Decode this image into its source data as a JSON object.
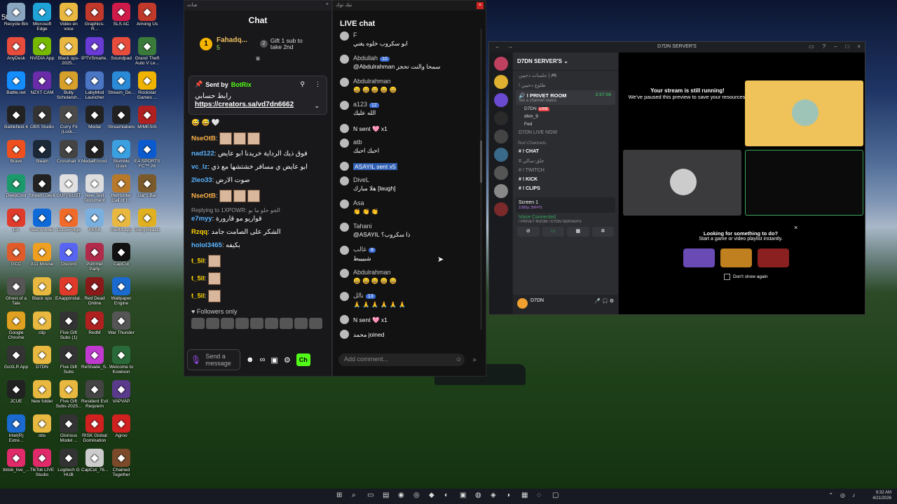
{
  "desktop": {
    "money_text": "50,00$",
    "icons": [
      {
        "label": "Recycle Bin",
        "color": "#8aa6c1"
      },
      {
        "label": "Microsoft Edge",
        "color": "#1fa3d6"
      },
      {
        "label": "Vidéo en voce",
        "color": "#e8b840"
      },
      {
        "label": "Graphics-R...",
        "color": "#c0392b"
      },
      {
        "label": "SLS AC",
        "color": "#d01b4a"
      },
      {
        "label": "Among Us",
        "color": "#c0392b"
      },
      {
        "label": "AnyDesk",
        "color": "#e74c3c"
      },
      {
        "label": "NVIDIA App",
        "color": "#76b900"
      },
      {
        "label": "Black ops-2025...",
        "color": "#e8b840"
      },
      {
        "label": "IPTVSmarte...",
        "color": "#6a3ad4"
      },
      {
        "label": "Soundpad",
        "color": "#e74c3c"
      },
      {
        "label": "Grand Theft Auto V Le...",
        "color": "#3a7a3a"
      },
      {
        "label": "Battle.net",
        "color": "#148eff"
      },
      {
        "label": "NZXT CAM",
        "color": "#6a2ca8"
      },
      {
        "label": "Bully Scholarsh...",
        "color": "#d6a02a"
      },
      {
        "label": "LabyMod Launcher",
        "color": "#4a76c4"
      },
      {
        "label": "Stream_De...",
        "color": "#2a8ad6"
      },
      {
        "label": "Rockstar Games ...",
        "color": "#f0b400"
      },
      {
        "label": "Battlefield 6",
        "color": "#222"
      },
      {
        "label": "OBS Studio",
        "color": "#333"
      },
      {
        "label": "Curry Fit (Lock...",
        "color": "#4a4a4a"
      },
      {
        "label": "Medal",
        "color": "#222"
      },
      {
        "label": "Streamlabels",
        "color": "#222"
      },
      {
        "label": "MIMESIS",
        "color": "#b02020"
      },
      {
        "label": "Brave",
        "color": "#f0501e"
      },
      {
        "label": "Steam",
        "color": "#1b2838"
      },
      {
        "label": "Crosshair X",
        "color": "#444"
      },
      {
        "label": "MedalEncod...",
        "color": "#222"
      },
      {
        "label": "Stumble Guys",
        "color": "#3aa0e0"
      },
      {
        "label": "EA SPORTS FC™ 26",
        "color": "#0a5ad0"
      },
      {
        "label": "DeepCool",
        "color": "#1a9a6a"
      },
      {
        "label": "Stream Deck",
        "color": "#222"
      },
      {
        "label": "GUFFBUST",
        "color": "#e0e0e0"
      },
      {
        "label": "New Text Document",
        "color": "#dddddd"
      },
      {
        "label": "theHunter Call of t...",
        "color": "#b87a2a"
      },
      {
        "label": "Liar's Bar",
        "color": "#7a5a2a"
      },
      {
        "label": "EA",
        "color": "#e03a2a"
      },
      {
        "label": "TeamViewer",
        "color": "#0e6ad8"
      },
      {
        "label": "CurseForge",
        "color": "#f06a2a"
      },
      {
        "label": "PEAK",
        "color": "#7ab0e0"
      },
      {
        "label": "RedM.app",
        "color": "#e8b840"
      },
      {
        "label": "Gang Beasts",
        "color": "#e0b020"
      },
      {
        "label": "GCC",
        "color": "#e05a2a"
      },
      {
        "label": "X11 Mouse",
        "color": "#f0a020"
      },
      {
        "label": "Discord",
        "color": "#5865f2"
      },
      {
        "label": "Pummel Party",
        "color": "#b02a4a"
      },
      {
        "label": "CapCut",
        "color": "#111"
      },
      {
        "label": "Ghost of a Tale",
        "color": "#555"
      },
      {
        "label": "Black ops",
        "color": "#e8b840"
      },
      {
        "label": "EAappinstal...",
        "color": "#e03a2a"
      },
      {
        "label": "Red Dead Online",
        "color": "#8a1a1a"
      },
      {
        "label": "Wallpaper Engine",
        "color": "#1a6ad0"
      },
      {
        "label": "Google Chrome",
        "color": "#e0a020"
      },
      {
        "label": "clip",
        "color": "#e8b840"
      },
      {
        "label": "Five Gift Subs (1)",
        "color": "#333"
      },
      {
        "label": "RedM",
        "color": "#b02020"
      },
      {
        "label": "War Thunder",
        "color": "#555"
      },
      {
        "label": "GoXLR App",
        "color": "#333"
      },
      {
        "label": "D7DN",
        "color": "#e8b840"
      },
      {
        "label": "Five Gift Subs",
        "color": "#333"
      },
      {
        "label": "ReShade_S...",
        "color": "#c03ad0"
      },
      {
        "label": "Welcome to Kowloon",
        "color": "#2a6a3a"
      },
      {
        "label": "JCUE",
        "color": "#222"
      },
      {
        "label": "New folder",
        "color": "#e8b840"
      },
      {
        "label": "Five Gift Subs-2025...",
        "color": "#e8b840"
      },
      {
        "label": "Resident Evil Requiem",
        "color": "#444"
      },
      {
        "label": "VAPVAP",
        "color": "#5a3a8a"
      },
      {
        "label": "Intel(R) Extre...",
        "color": "#1a6ad0"
      },
      {
        "label": "obs",
        "color": "#e8b840"
      },
      {
        "label": "Glorious Model ...",
        "color": "#333"
      },
      {
        "label": "RISK Global Domination",
        "color": "#d02020"
      },
      {
        "label": "Agroo",
        "color": "#d02020"
      },
      {
        "label": "tiktok_live_...",
        "color": "#e02a6a"
      },
      {
        "label": "TikTok LIVE Studio",
        "color": "#e02a6a"
      },
      {
        "label": "Logitech G HUB",
        "color": "#333"
      },
      {
        "label": "CapCut_76...",
        "color": "#ccc"
      },
      {
        "label": "Chained Together",
        "color": "#7a4a2a"
      }
    ]
  },
  "chat1": {
    "titlebar": "شات",
    "title": "Chat",
    "gift": {
      "rank": "1",
      "name": "Fahadq...",
      "count": "5",
      "rank2": "2",
      "cta": "Gift 1 sub to take 2nd"
    },
    "pinned": {
      "sent_by": "Sent by",
      "bot": "BotRix",
      "text": "رابط حسابي",
      "link": "https://creators.sa/vd7dn6662"
    },
    "messages": [
      {
        "user": "",
        "text": "😅 😅 🤍",
        "stickers": 0
      },
      {
        "user": "NseOtB",
        "text": "",
        "stickers": 3
      },
      {
        "user": "nad122",
        "text": "فوق ذيك الرداية خريدنا ابو عايض"
      },
      {
        "user": "vc_lz",
        "text": "ابو عايض ي مسافر خشتشها مع ذي"
      },
      {
        "user": "2leo33",
        "text": "صوت الارض"
      },
      {
        "user": "NseOtB",
        "text": "",
        "stickers": 3
      },
      {
        "user": "e7myy",
        "text": "قواريو مو قارورة",
        "reply": "Replying to 1XPOWR: الجو حلو ما بو"
      },
      {
        "user": "Rzqq",
        "text": "الشكر على الصامت جامد"
      },
      {
        "user": "holol3465",
        "text": "بكيفه"
      },
      {
        "user": "t_5ll",
        "text": "",
        "stickers": 1
      },
      {
        "user": "t_5ll",
        "text": "",
        "stickers": 1
      },
      {
        "user": "t_5ll",
        "text": "",
        "stickers": 1
      }
    ],
    "followers_only": "Followers only",
    "input_placeholder": "Send a message",
    "chat_button": "Ch"
  },
  "chat2": {
    "titlebar": "تيك توك",
    "title": "LIVE chat",
    "messages": [
      {
        "user": "F",
        "text": "ابو سكروب خلوه يغني"
      },
      {
        "user": "Abdullah",
        "badge": "10",
        "text": "@Abdulrahman سمحا والنت تحجز"
      },
      {
        "user": "Abdulrahman",
        "text": "😄 😄 😄 😄 😄"
      },
      {
        "user": "a123",
        "badge": "12",
        "text": "الله عليك"
      },
      {
        "user": "N",
        "text": "sent 🩷 x1",
        "sent": true
      },
      {
        "user": "atb",
        "text": "احبك احبك"
      },
      {
        "user": "ASAYIL",
        "text": "sent  x5",
        "highlight": true
      },
      {
        "user": "DiveL",
        "text": "هلا مبارك [laugh]"
      },
      {
        "user": "Asa",
        "text": "👏 👏 👏"
      },
      {
        "user": "Tahani",
        "text": "@ASAYIL ذا سكروب؟"
      },
      {
        "user": "غالب",
        "badge": "8",
        "text": "شبيييط"
      },
      {
        "user": "Abdulrahman",
        "text": "😄 😄 😄 😄 😄"
      },
      {
        "user": "نالل",
        "badge": "13",
        "text": "🙏 🙏 🙏 🙏 🙏 🙏"
      },
      {
        "user": "N",
        "text": "sent 🩷 x1",
        "sent": true
      },
      {
        "user": "محمد",
        "text": "joined",
        "joined": true
      }
    ],
    "add_comment": "Add comment..."
  },
  "discord": {
    "titlebar": "D7DN SERVER'S",
    "server": "D7DN SERVER'S",
    "channels": [
      {
        "name": "جلسات دحيين | 🎮",
        "bold": false
      },
      {
        "name": "! طلوع دحيين",
        "bold": false
      }
    ],
    "voice": {
      "room": "! PRIVET ROOM",
      "sub": "Set a channel status",
      "timer": "2:57:08",
      "users": [
        "D7DN",
        "dhm_9",
        "Fed"
      ]
    },
    "live_now": "D7DN LIVE NOW",
    "text_section": "Text Channels",
    "text_channels": [
      "! CHAT",
      "حلق-سالي",
      "! TWITCH",
      "! KICK",
      "! CLIPS"
    ],
    "screen": "Screen 1",
    "screen_sub": "1080p 30FPS",
    "voice_connected": "Voice Connected",
    "voice_sub": "! PRIVET ROOM / D7DN SERVER'S",
    "user": "D7DN",
    "stream_title": "Your stream is still running!",
    "stream_sub": "We've paused this preview to save your resources.",
    "look_title": "Looking for something to do?",
    "look_sub": "Start a game or video playlist instantly.",
    "dont_show": "Don't show again",
    "live_badge": "LIVE"
  },
  "taskbar": {
    "time": "8:32 AM",
    "date": "4/21/2026"
  }
}
